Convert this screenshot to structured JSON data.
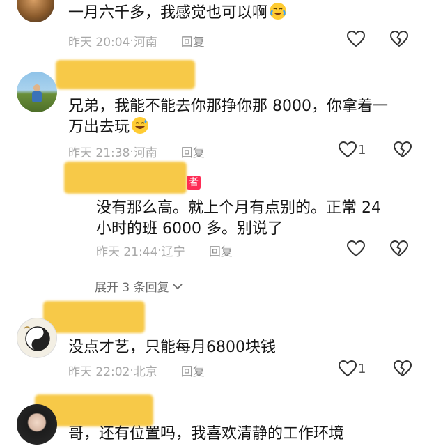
{
  "comments": [
    {
      "text": "一月六千多，我感觉也可以啊",
      "emoji": "crying-laughing",
      "time": "昨天 20:04",
      "location": "河南",
      "reply_label": "回复",
      "likes": ""
    },
    {
      "line1": "兄弟，我能不能去你那挣你那 8000，你拿着一",
      "line2": "万出去玩",
      "emoji": "grinning-sweat",
      "time": "昨天 21:38",
      "location": "河南",
      "reply_label": "回复",
      "likes": "1"
    },
    {
      "author_tag": "者",
      "line1": "没有那么高。就上个月有点别的。正常 24",
      "line2": "小时的班 6000 多。别说了",
      "time": "昨天 21:44",
      "location": "辽宁",
      "reply_label": "回复",
      "likes": ""
    },
    {
      "text": "没点才艺，只能每月6800块钱",
      "time": "昨天 22:02",
      "location": "北京",
      "reply_label": "回复",
      "likes": "1"
    },
    {
      "text": "哥，还有位置吗，我喜欢清静的工作环境"
    }
  ],
  "expand_replies": "展开 3 条回复",
  "colors": {
    "name_highlight": "#f7c948",
    "author_tag": "#fe2c55",
    "meta": "#a8a8a8"
  }
}
